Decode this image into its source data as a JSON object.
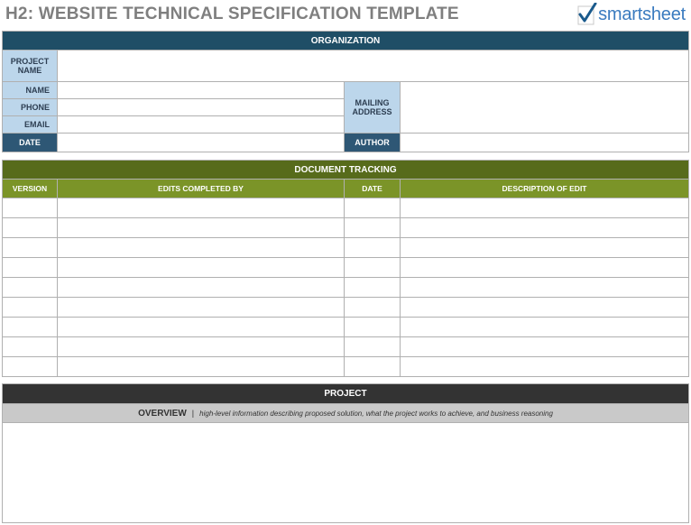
{
  "header": {
    "title": "H2: WEBSITE TECHNICAL SPECIFICATION TEMPLATE",
    "logo_text": "smartsheet",
    "logo_icon": "checkmark-icon"
  },
  "organization": {
    "heading": "ORGANIZATION",
    "project_name_label": "PROJECT NAME",
    "name_label": "NAME",
    "phone_label": "PHONE",
    "email_label": "EMAIL",
    "mailing_address_label": "MAILING ADDRESS",
    "date_label": "DATE",
    "author_label": "AUTHOR"
  },
  "document_tracking": {
    "heading": "DOCUMENT TRACKING",
    "columns": [
      "VERSION",
      "EDITS COMPLETED BY",
      "DATE",
      "DESCRIPTION OF EDIT"
    ],
    "rows": [
      [
        "",
        "",
        "",
        ""
      ],
      [
        "",
        "",
        "",
        ""
      ],
      [
        "",
        "",
        "",
        ""
      ],
      [
        "",
        "",
        "",
        ""
      ],
      [
        "",
        "",
        "",
        ""
      ],
      [
        "",
        "",
        "",
        ""
      ],
      [
        "",
        "",
        "",
        ""
      ],
      [
        "",
        "",
        "",
        ""
      ],
      [
        "",
        "",
        "",
        ""
      ]
    ]
  },
  "project": {
    "heading": "PROJECT",
    "overview_title": "OVERVIEW",
    "overview_separator": "|",
    "overview_description": "high-level information describing proposed solution, what the project works to achieve, and business reasoning"
  },
  "colors": {
    "org_header": "#1f4e66",
    "label_blue": "#bcd6eb",
    "label_dark": "#2e5775",
    "tracking_header": "#576b1b",
    "tracking_subheader": "#7b9428",
    "project_header": "#333333",
    "overview_bar": "#c9c9c9",
    "logo_blue": "#3a7bbf"
  }
}
